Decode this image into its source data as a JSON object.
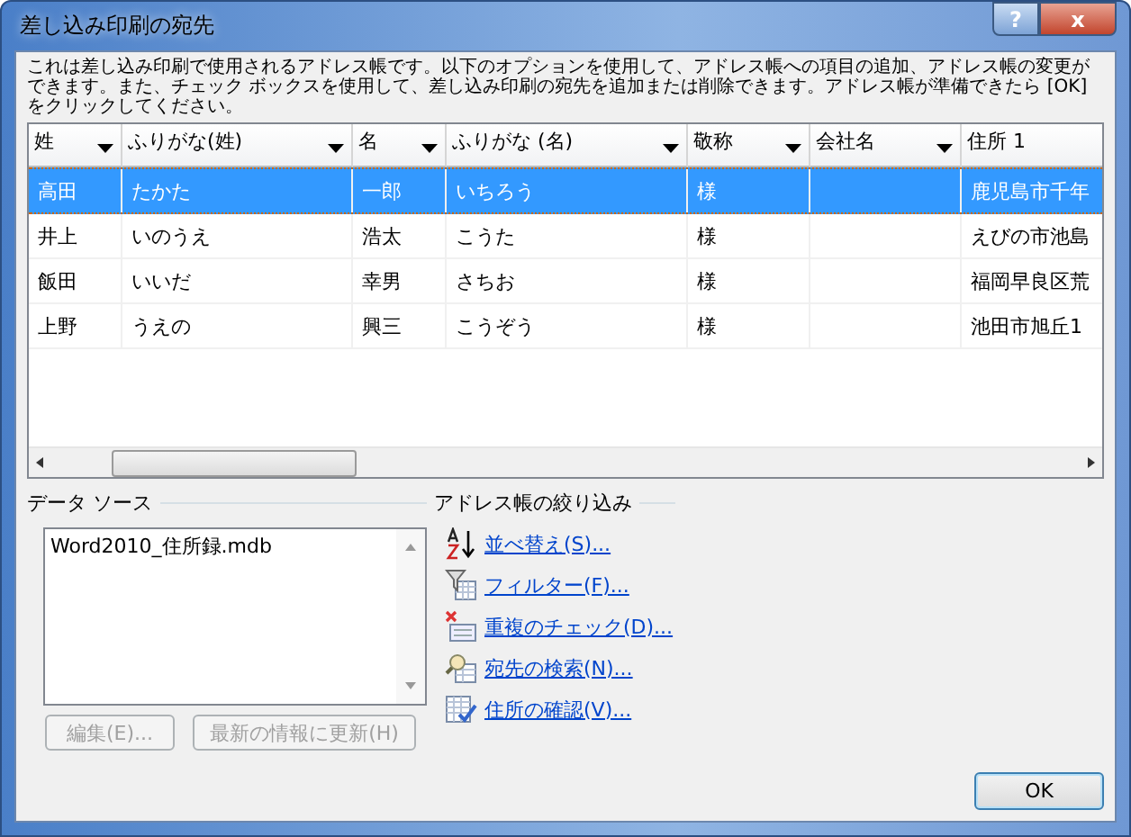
{
  "window": {
    "title": "差し込み印刷の宛先",
    "help_button": "?",
    "close_button": "x"
  },
  "description": "これは差し込み印刷で使用されるアドレス帳です。以下のオプションを使用して、アドレス帳への項目の追加、アドレス帳の変更ができます。また、チェック ボックスを使用して、差し込み印刷の宛先を追加または削除できます。アドレス帳が準備できたら [OK] をクリックしてください。",
  "table": {
    "columns": [
      "姓",
      "ふりがな(姓)",
      "名",
      "ふりがな (名)",
      "敬称",
      "会社名",
      "住所 1"
    ],
    "rows": [
      {
        "cells": [
          "高田",
          "たかた",
          "一郎",
          "いちろう",
          "様",
          "",
          "鹿児島市千年"
        ],
        "selected": true
      },
      {
        "cells": [
          "井上",
          "いのうえ",
          "浩太",
          "こうた",
          "様",
          "",
          "えびの市池島"
        ],
        "selected": false
      },
      {
        "cells": [
          "飯田",
          "いいだ",
          "幸男",
          "さちお",
          "様",
          "",
          "福岡早良区荒"
        ],
        "selected": false
      },
      {
        "cells": [
          "上野",
          "うえの",
          "興三",
          "こうぞう",
          "様",
          "",
          "池田市旭丘1"
        ],
        "selected": false
      }
    ]
  },
  "data_source": {
    "label": "データ ソース",
    "items": [
      "Word2010_住所録.mdb"
    ],
    "buttons": [
      {
        "label": "編集(E)...",
        "disabled": true
      },
      {
        "label": "最新の情報に更新(H)",
        "disabled": true
      }
    ]
  },
  "refine": {
    "label": "アドレス帳の絞り込み",
    "links": [
      {
        "kind": "sort",
        "label": "並べ替え(S)..."
      },
      {
        "kind": "filter",
        "label": "フィルター(F)..."
      },
      {
        "kind": "duplicates",
        "label": "重複のチェック(D)..."
      },
      {
        "kind": "find",
        "label": "宛先の検索(N)..."
      },
      {
        "kind": "validate",
        "label": "住所の確認(V)..."
      }
    ]
  },
  "ok_button": "OK"
}
